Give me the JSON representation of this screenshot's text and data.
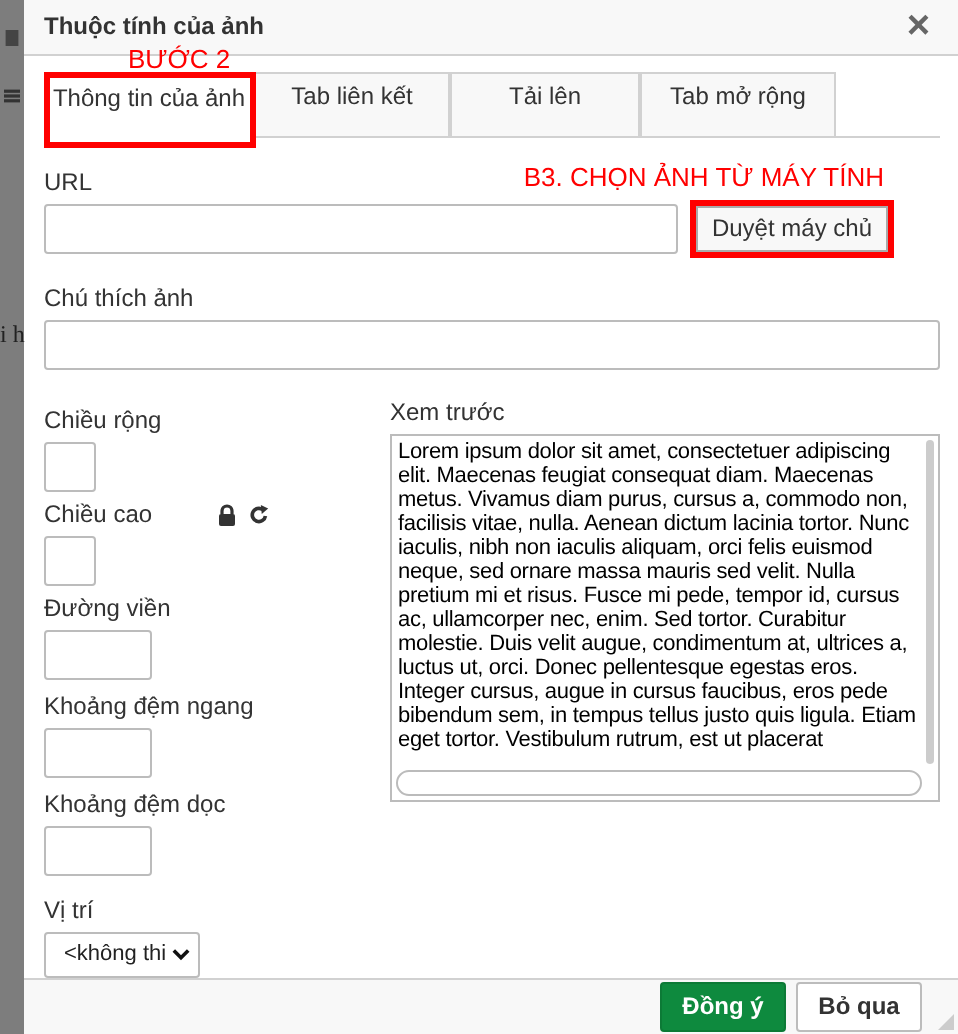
{
  "background_text": "i h",
  "window": {
    "title": "Thuộc tính của ảnh",
    "close": "×"
  },
  "tabs": [
    {
      "label": "Thông tin của ảnh",
      "selected": true
    },
    {
      "label": "Tab liên kết",
      "selected": false
    },
    {
      "label": "Tải lên",
      "selected": false
    },
    {
      "label": "Tab mở rộng",
      "selected": false
    }
  ],
  "annotations": [
    {
      "text": "BƯỚC 2"
    },
    {
      "text": "B3. CHỌN ẢNH TỪ MÁY TÍNH"
    }
  ],
  "url": {
    "label": "URL",
    "browse_button": "Duyệt máy chủ"
  },
  "caption": {
    "label": "Chú thích ảnh"
  },
  "fields": [
    {
      "label": "Chiều rộng"
    },
    {
      "label": "Chiều cao",
      "lock_icons": true
    },
    {
      "label": "Đường viền"
    },
    {
      "label": "Khoảng đệm ngang"
    },
    {
      "label": "Khoảng đệm dọc"
    }
  ],
  "alignment": {
    "label": "Vị trí",
    "value": "<không thi"
  },
  "preview": {
    "label": "Xem trước",
    "text": "Lorem ipsum dolor sit amet, consectetuer adipiscing elit. Maecenas feugiat consequat diam. Maecenas metus. Vivamus diam purus, cursus a, commodo non, facilisis vitae, nulla. Aenean dictum lacinia tortor. Nunc iaculis, nibh non iaculis aliquam, orci felis euismod neque, sed ornare massa mauris sed velit. Nulla pretium mi et risus. Fusce mi pede, tempor id, cursus ac, ullamcorper nec, enim. Sed tortor. Curabitur molestie. Duis velit augue, condimentum at, ultrices a, luctus ut, orci. Donec pellentesque egestas eros. Integer cursus, augue in cursus faucibus, eros pede bibendum sem, in tempus tellus justo quis ligula. Etiam eget tortor. Vestibulum rutrum, est ut placerat"
  },
  "buttons": [
    {
      "label": "Đồng ý",
      "kind": "primary"
    },
    {
      "label": "Bỏ qua",
      "kind": "secondary"
    }
  ]
}
